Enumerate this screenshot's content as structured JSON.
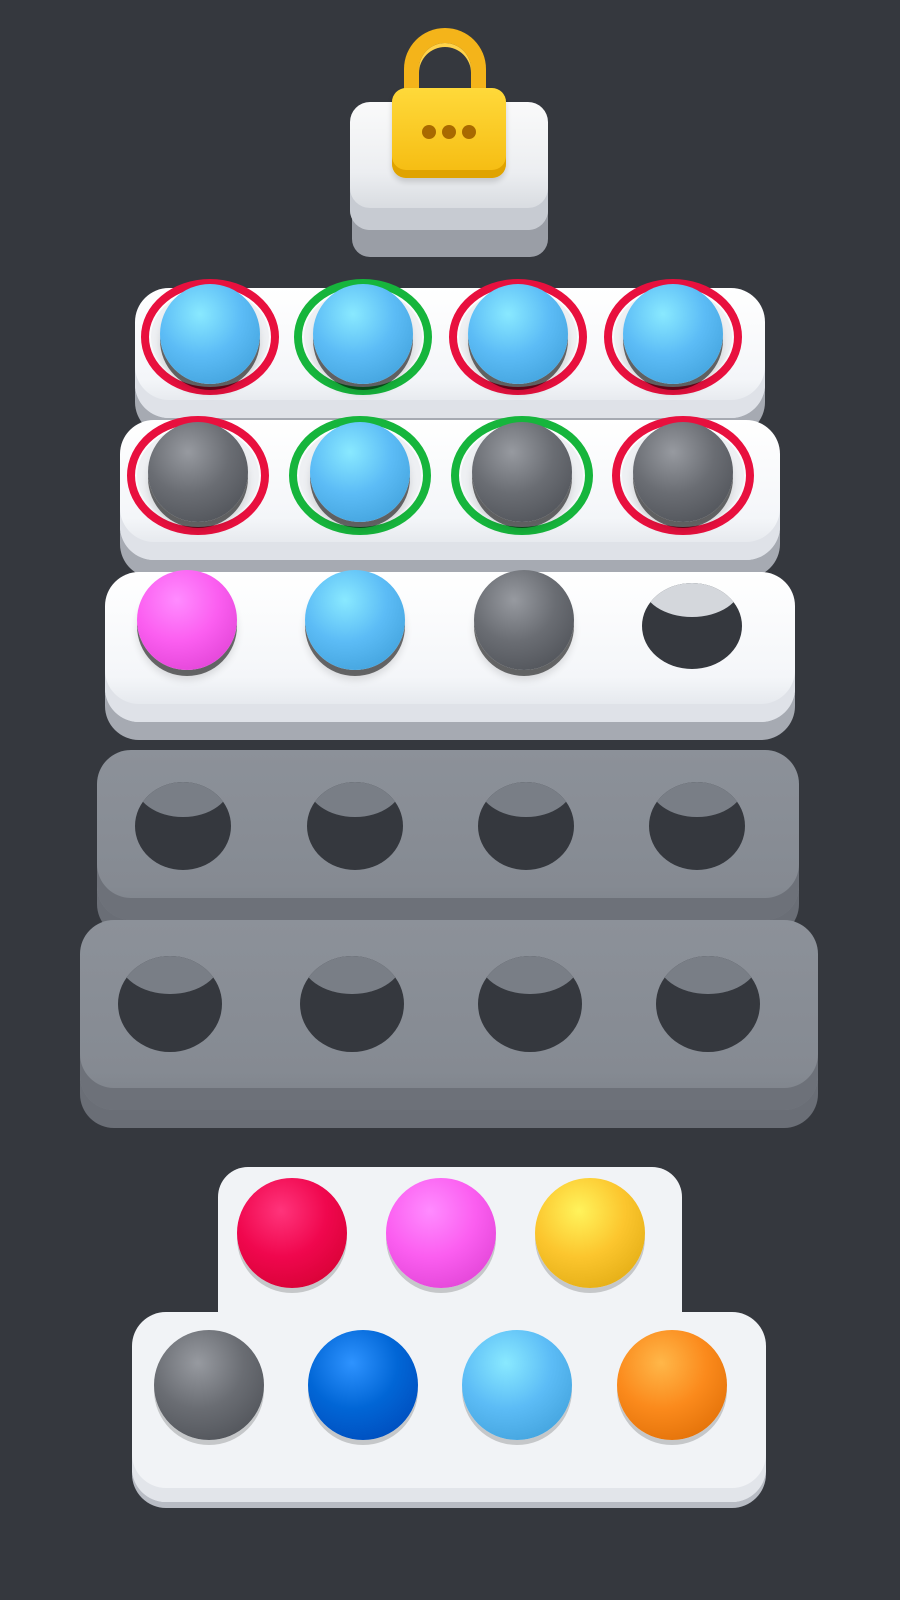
{
  "scene": "ball-sort-puzzle",
  "colors": {
    "background": "#35383e",
    "ring_correct": "#16b53c",
    "ring_wrong": "#e8103e",
    "lock_gold": "#f5bb10"
  },
  "ball_colors": {
    "light-blue": "#5cbcf6",
    "gray": "#6a6d73",
    "pink": "#fb5ef0",
    "red": "#f0074e",
    "yellow": "#fcc62e",
    "dark-blue": "#0166d6",
    "orange": "#fb8a1c"
  },
  "locked_row": {
    "icon": "padlock-icon",
    "dots": 3
  },
  "rows": [
    {
      "state": "submitted",
      "cells": [
        {
          "ball": "light-blue",
          "ring": "red"
        },
        {
          "ball": "light-blue",
          "ring": "green"
        },
        {
          "ball": "light-blue",
          "ring": "red"
        },
        {
          "ball": "light-blue",
          "ring": "red"
        }
      ]
    },
    {
      "state": "submitted",
      "cells": [
        {
          "ball": "gray",
          "ring": "red"
        },
        {
          "ball": "light-blue",
          "ring": "green"
        },
        {
          "ball": "gray",
          "ring": "green"
        },
        {
          "ball": "gray",
          "ring": "red"
        }
      ]
    },
    {
      "state": "active",
      "cells": [
        {
          "ball": "pink"
        },
        {
          "ball": "light-blue"
        },
        {
          "ball": "gray"
        },
        {
          "ball": null
        }
      ]
    },
    {
      "state": "inactive",
      "cells": [
        {
          "ball": null
        },
        {
          "ball": null
        },
        {
          "ball": null
        },
        {
          "ball": null
        }
      ]
    },
    {
      "state": "inactive",
      "cells": [
        {
          "ball": null
        },
        {
          "ball": null
        },
        {
          "ball": null
        },
        {
          "ball": null
        }
      ]
    }
  ],
  "palette": {
    "top": [
      "red",
      "pink",
      "yellow"
    ],
    "bottom": [
      "gray",
      "dark-blue",
      "light-blue",
      "orange"
    ]
  }
}
